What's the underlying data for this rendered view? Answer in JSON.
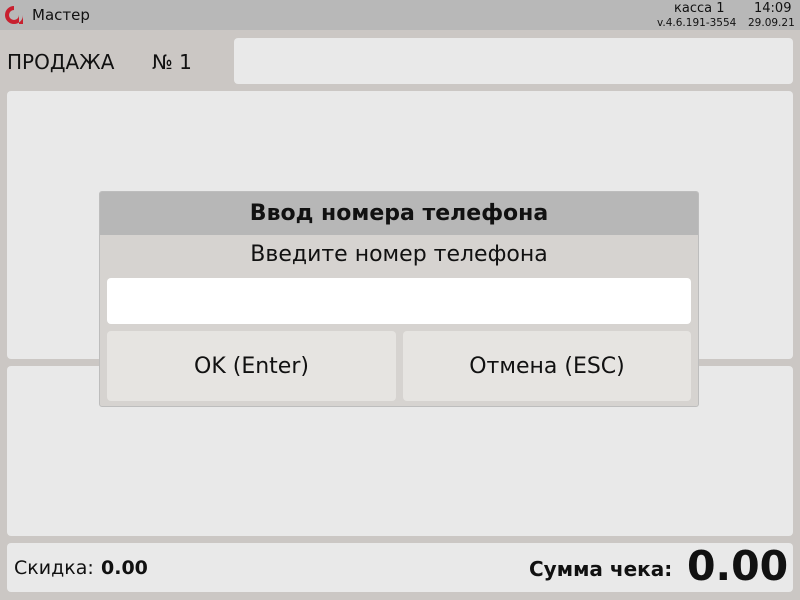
{
  "app": {
    "title": "Мастер",
    "kassa": "касса 1",
    "time": "14:09",
    "version": "v.4.6.191-3554",
    "date": "29.09.21",
    "logo_icon": "app-logo-icon",
    "accent_color": "#c8202f"
  },
  "sale": {
    "title": "ПРОДАЖА",
    "number": "№ 1",
    "field_value": ""
  },
  "footer": {
    "discount_label": "Скидка:",
    "discount_value": "0.00",
    "total_label": "Сумма чека:",
    "total_value": "0.00"
  },
  "dialog": {
    "title": "Ввод номера телефона",
    "prompt": "Введите номер телефона",
    "phone_value": "",
    "ok_label": "OK (Enter)",
    "cancel_label": "Отмена (ESC)"
  }
}
